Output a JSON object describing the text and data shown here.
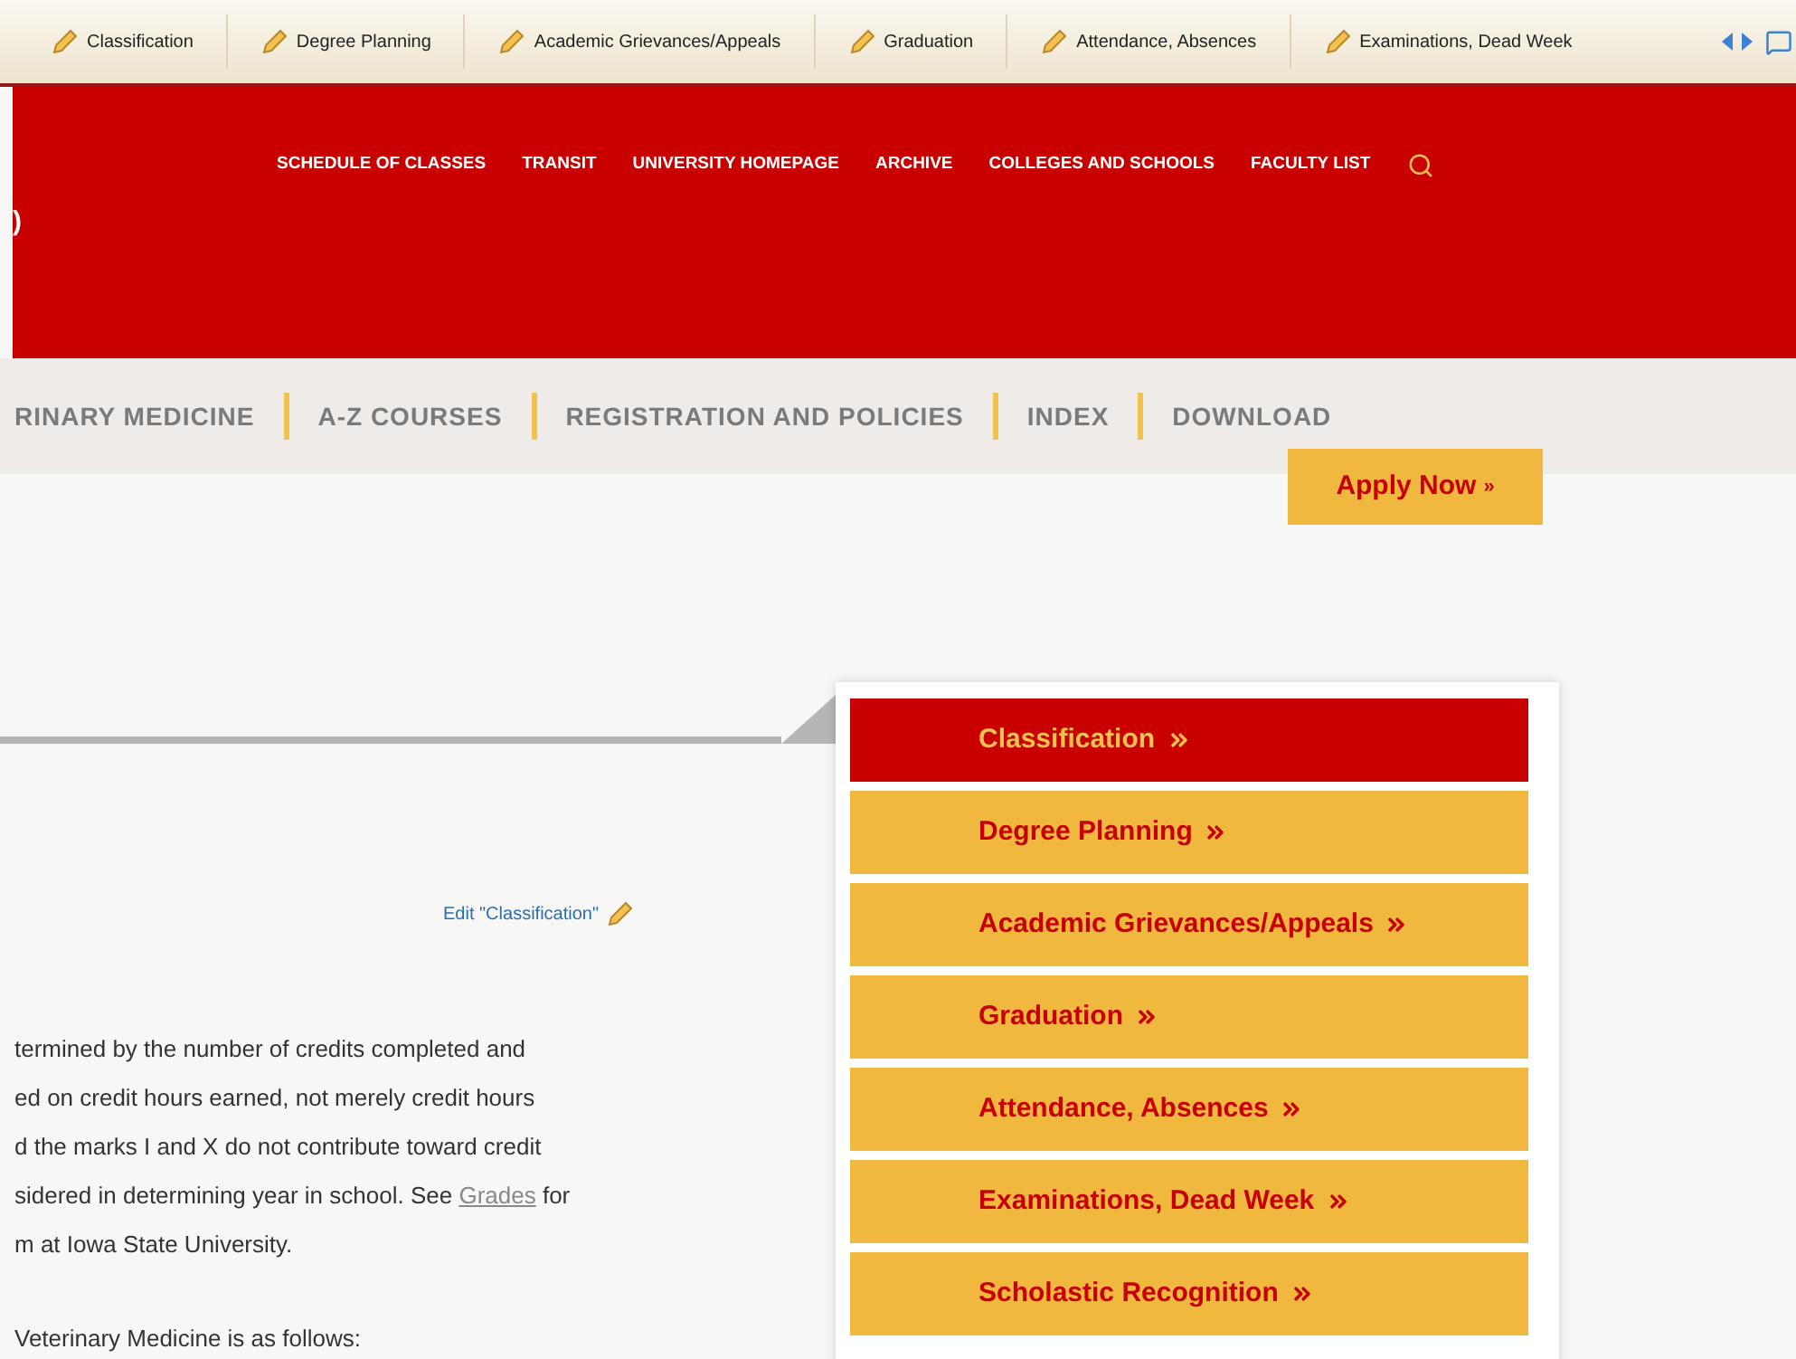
{
  "edit_toolbar": {
    "items": [
      {
        "label": "Classification"
      },
      {
        "label": "Degree Planning"
      },
      {
        "label": "Academic Grievances/Appeals"
      },
      {
        "label": "Graduation"
      },
      {
        "label": "Attendance, Absences"
      },
      {
        "label": "Examinations, Dead Week"
      }
    ]
  },
  "header": {
    "title_fragment": ")",
    "links": [
      "SCHEDULE OF CLASSES",
      "TRANSIT",
      "UNIVERSITY HOMEPAGE",
      "ARCHIVE",
      "COLLEGES AND SCHOOLS",
      "FACULTY LIST"
    ]
  },
  "main_nav": {
    "items": [
      "RINARY MEDICINE",
      "A-Z COURSES",
      "REGISTRATION AND POLICIES",
      "INDEX",
      "DOWNLOAD"
    ]
  },
  "apply_button": {
    "label": "Apply Now",
    "arrow": "»"
  },
  "edit_link": "Edit \"Classification\"",
  "paragraph_lines": [
    {
      "text": "termined by the number of credits completed and"
    },
    {
      "text": "ed on credit hours earned, not merely credit hours"
    },
    {
      "text": "d the marks I and X do not contribute toward credit"
    },
    {
      "text": "sidered in determining year in school. See ",
      "link": "Grades",
      "after": " for"
    },
    {
      "text": "m at Iowa State University."
    }
  ],
  "closing_line": "Veterinary Medicine is as follows:",
  "side_menu": [
    {
      "label": "Classification",
      "selected": true
    },
    {
      "label": "Degree Planning",
      "selected": false
    },
    {
      "label": "Academic Grievances/Appeals",
      "selected": false
    },
    {
      "label": "Graduation",
      "selected": false
    },
    {
      "label": "Attendance, Absences",
      "selected": false
    },
    {
      "label": "Examinations, Dead Week",
      "selected": false
    },
    {
      "label": "Scholastic Recognition",
      "selected": false
    }
  ]
}
